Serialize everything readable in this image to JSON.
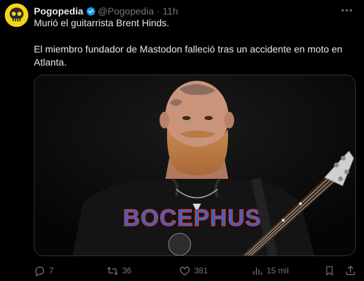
{
  "tweet": {
    "display_name": "Pogopedia",
    "handle": "@Pogopedia",
    "separator": "·",
    "timestamp": "11h",
    "line1": "Murió el guitarrista Brent Hinds.",
    "line2": "El miembro fundador de Mastodon falleció tras un accidente en moto en Atlanta.",
    "shirt_text": "BOCEPHUS"
  },
  "actions": {
    "reply_count": "7",
    "retweet_count": "36",
    "like_count": "381",
    "views_count": "15 mil"
  },
  "icons": {
    "verified": "verified-badge-icon",
    "more": "more-options-icon",
    "reply": "reply-icon",
    "retweet": "retweet-icon",
    "like": "like-icon",
    "views": "views-icon",
    "bookmark": "bookmark-icon",
    "share": "share-icon"
  },
  "colors": {
    "background": "#000000",
    "text": "#e7e9ea",
    "secondary": "#71767b",
    "verified_blue": "#1d9bf0",
    "avatar_yellow": "#f7d417"
  }
}
